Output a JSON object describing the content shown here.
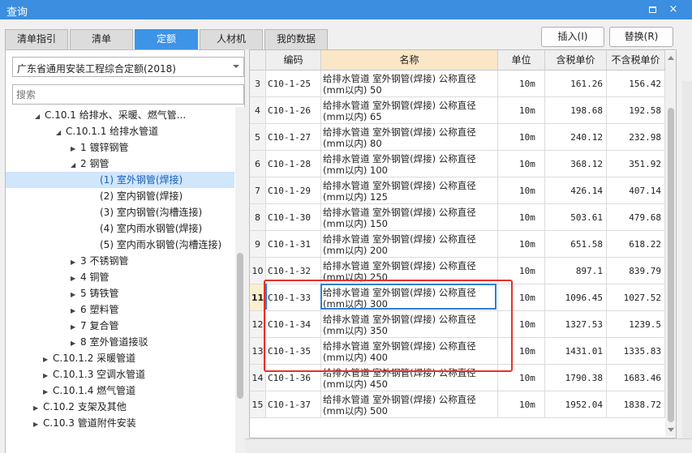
{
  "window": {
    "title": "查询",
    "maximize_icon": "maximize-icon",
    "close_icon": "close-icon",
    "close_glyph": "×"
  },
  "tabs": [
    {
      "label": "清单指引",
      "active": false
    },
    {
      "label": "清单",
      "active": false
    },
    {
      "label": "定额",
      "active": true
    },
    {
      "label": "人材机",
      "active": false
    },
    {
      "label": "我的数据",
      "active": false
    }
  ],
  "library_select": {
    "value": "广东省通用安装工程综合定额(2018)"
  },
  "search": {
    "placeholder": "搜索"
  },
  "tree": [
    {
      "label": "C.10.1 给排水、采暖、燃气管...",
      "toggle": "◢",
      "selected": false
    },
    {
      "label": "C.10.1.1 给排水管道",
      "toggle": "◢",
      "selected": false
    },
    {
      "label": "1 镀锌钢管",
      "toggle": "▶",
      "selected": false
    },
    {
      "label": "2 钢管",
      "toggle": "◢",
      "selected": false
    },
    {
      "label": "(1) 室外钢管(焊接)",
      "toggle": "",
      "selected": true
    },
    {
      "label": "(2) 室内钢管(焊接)",
      "toggle": "",
      "selected": false
    },
    {
      "label": "(3) 室内钢管(沟槽连接)",
      "toggle": "",
      "selected": false
    },
    {
      "label": "(4) 室内雨水钢管(焊接)",
      "toggle": "",
      "selected": false
    },
    {
      "label": "(5) 室内雨水钢管(沟槽连接)",
      "toggle": "",
      "selected": false
    },
    {
      "label": "3 不锈钢管",
      "toggle": "▶",
      "selected": false
    },
    {
      "label": "4 铜管",
      "toggle": "▶",
      "selected": false
    },
    {
      "label": "5 铸铁管",
      "toggle": "▶",
      "selected": false
    },
    {
      "label": "6 塑料管",
      "toggle": "▶",
      "selected": false
    },
    {
      "label": "7 复合管",
      "toggle": "▶",
      "selected": false
    },
    {
      "label": "8 室外管道接驳",
      "toggle": "▶",
      "selected": false
    },
    {
      "label": "C.10.1.2 采暖管道",
      "toggle": "▶",
      "selected": false
    },
    {
      "label": "C.10.1.3 空调水管道",
      "toggle": "▶",
      "selected": false
    },
    {
      "label": "C.10.1.4 燃气管道",
      "toggle": "▶",
      "selected": false
    },
    {
      "label": "C.10.2 支架及其他",
      "toggle": "▶",
      "selected": false
    },
    {
      "label": "C.10.3 管道附件安装",
      "toggle": "▶",
      "selected": false
    }
  ],
  "actions": {
    "insert": "插入(I)",
    "replace": "替换(R)"
  },
  "table": {
    "columns": [
      "",
      "编码",
      "名称",
      "单位",
      "含税单价",
      "不含税单价"
    ],
    "rows": [
      {
        "no": "3",
        "code": "C10-1-25",
        "name1": "给排水管道 室外钢管(焊接) 公称直径",
        "name2": "(mm以内) 50",
        "unit": "10m",
        "price_tax": "161.26",
        "price_notax": "156.42"
      },
      {
        "no": "4",
        "code": "C10-1-26",
        "name1": "给排水管道 室外钢管(焊接) 公称直径",
        "name2": "(mm以内) 65",
        "unit": "10m",
        "price_tax": "198.68",
        "price_notax": "192.58"
      },
      {
        "no": "5",
        "code": "C10-1-27",
        "name1": "给排水管道 室外钢管(焊接) 公称直径",
        "name2": "(mm以内) 80",
        "unit": "10m",
        "price_tax": "240.12",
        "price_notax": "232.98"
      },
      {
        "no": "6",
        "code": "C10-1-28",
        "name1": "给排水管道 室外钢管(焊接) 公称直径",
        "name2": "(mm以内) 100",
        "unit": "10m",
        "price_tax": "368.12",
        "price_notax": "351.92"
      },
      {
        "no": "7",
        "code": "C10-1-29",
        "name1": "给排水管道 室外钢管(焊接) 公称直径",
        "name2": "(mm以内) 125",
        "unit": "10m",
        "price_tax": "426.14",
        "price_notax": "407.14"
      },
      {
        "no": "8",
        "code": "C10-1-30",
        "name1": "给排水管道 室外钢管(焊接) 公称直径",
        "name2": "(mm以内) 150",
        "unit": "10m",
        "price_tax": "503.61",
        "price_notax": "479.68"
      },
      {
        "no": "9",
        "code": "C10-1-31",
        "name1": "给排水管道 室外钢管(焊接) 公称直径",
        "name2": "(mm以内) 200",
        "unit": "10m",
        "price_tax": "651.58",
        "price_notax": "618.22"
      },
      {
        "no": "10",
        "code": "C10-1-32",
        "name1": "给排水管道 室外钢管(焊接) 公称直径",
        "name2": "(mm以内) 250",
        "unit": "10m",
        "price_tax": "897.1",
        "price_notax": "839.79"
      },
      {
        "no": "11",
        "code": "C10-1-33",
        "name1": "给排水管道 室外钢管(焊接) 公称直径",
        "name2": "(mm以内) 300",
        "unit": "10m",
        "price_tax": "1096.45",
        "price_notax": "1027.52"
      },
      {
        "no": "12",
        "code": "C10-1-34",
        "name1": "给排水管道 室外钢管(焊接) 公称直径",
        "name2": "(mm以内) 350",
        "unit": "10m",
        "price_tax": "1327.53",
        "price_notax": "1239.5"
      },
      {
        "no": "13",
        "code": "C10-1-35",
        "name1": "给排水管道 室外钢管(焊接) 公称直径",
        "name2": "(mm以内) 400",
        "unit": "10m",
        "price_tax": "1431.01",
        "price_notax": "1335.83"
      },
      {
        "no": "14",
        "code": "C10-1-36",
        "name1": "给排水管道 室外钢管(焊接) 公称直径",
        "name2": "(mm以内) 450",
        "unit": "10m",
        "price_tax": "1790.38",
        "price_notax": "1683.46"
      },
      {
        "no": "15",
        "code": "C10-1-37",
        "name1": "给排水管道 室外钢管(焊接) 公称直径",
        "name2": "(mm以内) 500",
        "unit": "10m",
        "price_tax": "1952.04",
        "price_notax": "1838.72"
      }
    ],
    "current_row": 8
  },
  "colors": {
    "titlebar": "#3b8ee0",
    "active_tab": "#3d94e6",
    "highlight_box": "#e8302a",
    "name_header": "#fbe7c6",
    "selected_tree": "#cfe6fb"
  }
}
